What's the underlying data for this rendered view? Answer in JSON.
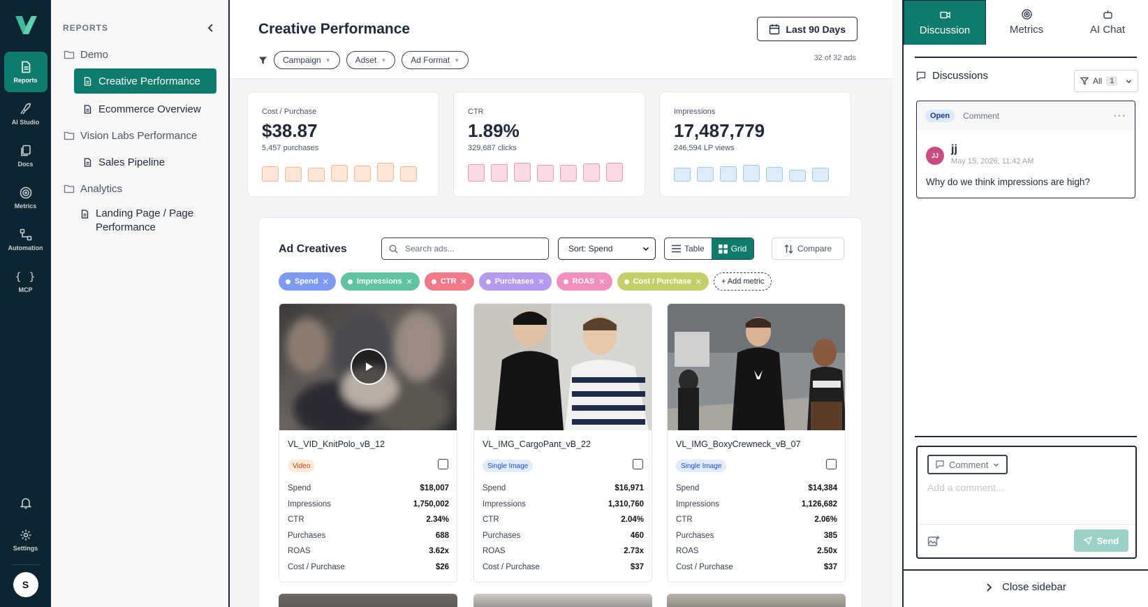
{
  "rail": {
    "items": [
      {
        "label": "Reports",
        "icon": "file-icon",
        "active": true
      },
      {
        "label": "AI Studio",
        "icon": "rocket-icon",
        "active": false
      },
      {
        "label": "Docs",
        "icon": "docs-icon",
        "active": false
      },
      {
        "label": "Metrics",
        "icon": "target-icon",
        "active": false
      },
      {
        "label": "Automation",
        "icon": "flow-icon",
        "active": false
      },
      {
        "label": "MCP",
        "icon": "braces-icon",
        "active": false
      }
    ],
    "settings_label": "Settings",
    "braces_glyph": "{ }",
    "user_initial": "S"
  },
  "reports": {
    "header": "REPORTS",
    "folders": [
      {
        "name": "Demo",
        "items": [
          "Creative Performance",
          "Ecommerce Overview"
        ]
      },
      {
        "name": "Vision Labs Performance",
        "items": [
          "Sales Pipeline"
        ]
      },
      {
        "name": "Analytics",
        "items": [
          "Landing Page / Page Performance"
        ]
      }
    ],
    "active_item": "Creative Performance"
  },
  "main": {
    "title": "Creative Performance",
    "date_range": "Last 90 Days",
    "filters": [
      "Campaign",
      "Adset",
      "Ad Format"
    ],
    "ad_count": "32 of 32 ads",
    "metrics": [
      {
        "label": "Cost / Purchase",
        "value": "$38.87",
        "sub": "5,457 purchases",
        "color": "#f7b99a",
        "fill": "#fde6d8",
        "spark": [
          0.78,
          0.74,
          0.72,
          0.86,
          0.82,
          0.96,
          0.8
        ]
      },
      {
        "label": "CTR",
        "value": "1.89%",
        "sub": "329,687 clicks",
        "color": "#ef9bb5",
        "fill": "#fadbe4",
        "spark": [
          0.88,
          0.9,
          0.98,
          0.84,
          0.86,
          0.92,
          0.96
        ]
      },
      {
        "label": "Impressions",
        "value": "17,487,779",
        "sub": "246,594 LP views",
        "color": "#9ecbe6",
        "fill": "#dcedf8",
        "spark": [
          0.72,
          0.76,
          0.78,
          0.86,
          0.74,
          0.62,
          0.7
        ]
      }
    ],
    "ad_panel": {
      "title": "Ad Creatives",
      "search_placeholder": "Search ads...",
      "sort_label": "Sort: Spend",
      "view_table": "Table",
      "view_grid": "Grid",
      "compare_label": "Compare",
      "metric_tags": [
        {
          "label": "Spend",
          "color": "#7b9af0"
        },
        {
          "label": "Impressions",
          "color": "#5fc3a0"
        },
        {
          "label": "CTR",
          "color": "#f07a8a"
        },
        {
          "label": "Purchases",
          "color": "#b59af0"
        },
        {
          "label": "ROAS",
          "color": "#f08fbd"
        },
        {
          "label": "Cost / Purchase",
          "color": "#c4cf6a"
        }
      ],
      "add_metric": "+ Add metric",
      "ads": [
        {
          "name": "VL_VID_KnitPolo_vB_12",
          "format": "Video",
          "badge_bg": "#fdebd8",
          "badge_fg": "#c2410c",
          "video": true,
          "stats": [
            [
              "Spend",
              "$18,007"
            ],
            [
              "Impressions",
              "1,750,002"
            ],
            [
              "CTR",
              "2.34%"
            ],
            [
              "Purchases",
              "688"
            ],
            [
              "ROAS",
              "3.62x"
            ],
            [
              "Cost / Purchase",
              "$26"
            ]
          ]
        },
        {
          "name": "VL_IMG_CargoPant_vB_22",
          "format": "Single Image",
          "badge_bg": "#e0ecfb",
          "badge_fg": "#1d4ed8",
          "video": false,
          "stats": [
            [
              "Spend",
              "$16,971"
            ],
            [
              "Impressions",
              "1,310,760"
            ],
            [
              "CTR",
              "2.04%"
            ],
            [
              "Purchases",
              "460"
            ],
            [
              "ROAS",
              "2.73x"
            ],
            [
              "Cost / Purchase",
              "$37"
            ]
          ]
        },
        {
          "name": "VL_IMG_BoxyCrewneck_vB_07",
          "format": "Single Image",
          "badge_bg": "#e0ecfb",
          "badge_fg": "#1d4ed8",
          "video": false,
          "stats": [
            [
              "Spend",
              "$14,384"
            ],
            [
              "Impressions",
              "1,126,682"
            ],
            [
              "CTR",
              "2.06%"
            ],
            [
              "Purchases",
              "385"
            ],
            [
              "ROAS",
              "2.50x"
            ],
            [
              "Cost / Purchase",
              "$37"
            ]
          ]
        }
      ]
    }
  },
  "right": {
    "tabs": [
      "Discussion",
      "Metrics",
      "AI Chat"
    ],
    "discussions_title": "Discussions",
    "filter_label": "All",
    "filter_count": "1",
    "comment": {
      "status": "Open",
      "type": "Comment",
      "initials": "JJ",
      "author": "jj",
      "date": "May 15, 2026, 11:42 AM",
      "text": "Why do we think impressions are high?"
    },
    "composer": {
      "type_label": "Comment",
      "placeholder": "Add a comment...",
      "send_label": "Send"
    },
    "close_label": "Close sidebar"
  }
}
